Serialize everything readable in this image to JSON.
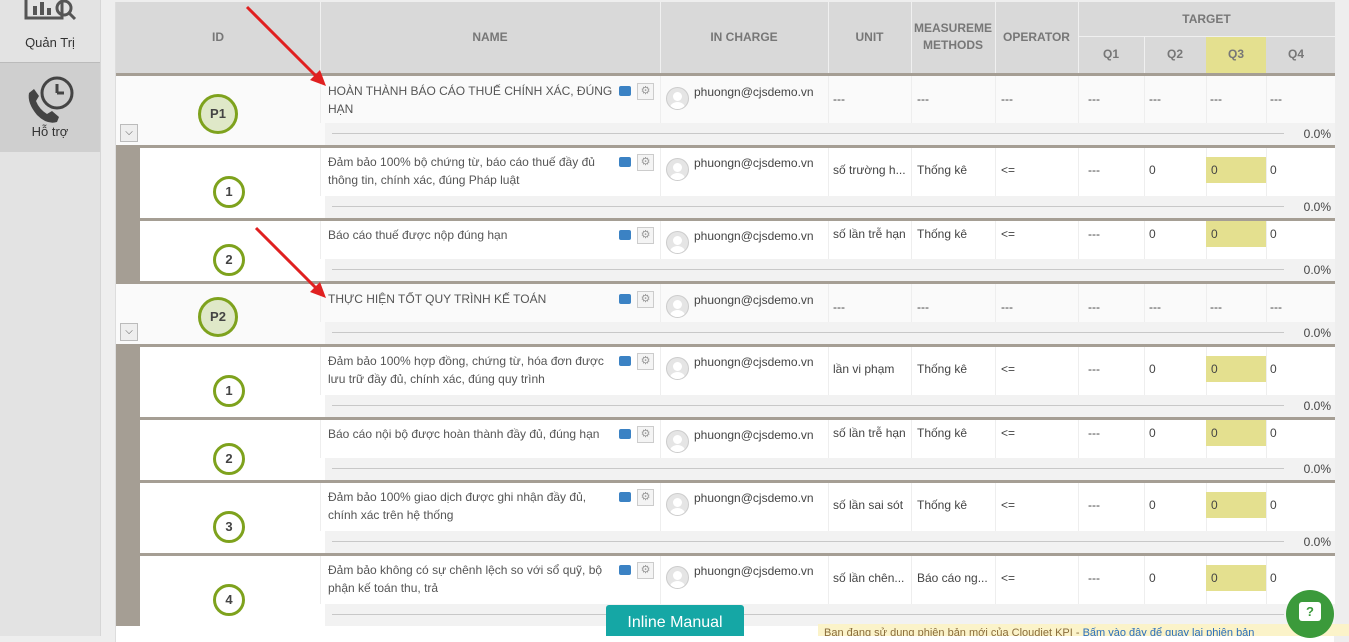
{
  "sidebar": {
    "items": [
      {
        "label": "Quản Trị",
        "icon": "admin-chart-icon"
      },
      {
        "label": "Hỗ trợ",
        "icon": "phone-clock-icon"
      }
    ]
  },
  "table": {
    "headers": {
      "id": "ID",
      "name": "NAME",
      "in_charge": "IN CHARGE",
      "unit": "UNIT",
      "methods": "MEASUREMENT METHODS",
      "methods_line1": "MEASUREME",
      "methods_line2": "METHODS",
      "operator": "OPERATOR",
      "target": "TARGET",
      "q1": "Q1",
      "q2": "Q2",
      "q3": "Q3",
      "q4": "Q4"
    },
    "rows": [
      {
        "type": "parent",
        "id": "P1",
        "name": "HOÀN THÀNH BÁO CÁO THUẾ CHÍNH XÁC, ĐÚNG HẠN",
        "in_charge": "phuongn@cjsdemo.vn",
        "unit": "---",
        "method": "---",
        "operator": "---",
        "q1": "---",
        "q2": "---",
        "q3": "---",
        "q4": "---",
        "progress": "0.0%"
      },
      {
        "type": "child",
        "id": "1",
        "name": "Đảm bảo 100% bộ chứng từ, báo cáo thuế đầy đủ thông tin, chính xác, đúng Pháp luật",
        "in_charge": "phuongn@cjsdemo.vn",
        "unit": "số trường h...",
        "method": "Thống kê",
        "operator": "<=",
        "q1": "---",
        "q2": "0",
        "q3": "0",
        "q4": "0",
        "progress": "0.0%"
      },
      {
        "type": "child",
        "id": "2",
        "name": "Báo cáo thuế được nộp đúng hạn",
        "in_charge": "phuongn@cjsdemo.vn",
        "unit": "số lần trễ hạn",
        "method": "Thống kê",
        "operator": "<=",
        "q1": "---",
        "q2": "0",
        "q3": "0",
        "q4": "0",
        "progress": "0.0%"
      },
      {
        "type": "parent",
        "id": "P2",
        "name": "THỰC HIỆN TỐT QUY TRÌNH KẾ TOÁN",
        "in_charge": "phuongn@cjsdemo.vn",
        "unit": "---",
        "method": "---",
        "operator": "---",
        "q1": "---",
        "q2": "---",
        "q3": "---",
        "q4": "---",
        "progress": "0.0%"
      },
      {
        "type": "child",
        "id": "1",
        "name": "Đảm bảo 100% hợp đồng, chứng từ, hóa đơn được lưu trữ đầy đủ, chính xác, đúng quy trình",
        "in_charge": "phuongn@cjsdemo.vn",
        "unit": "lần vi phạm",
        "method": "Thống kê",
        "operator": "<=",
        "q1": "---",
        "q2": "0",
        "q3": "0",
        "q4": "0",
        "progress": "0.0%"
      },
      {
        "type": "child",
        "id": "2",
        "name": "Báo cáo nội bộ được hoàn thành đầy đủ, đúng hạn",
        "in_charge": "phuongn@cjsdemo.vn",
        "unit": "số lần trễ hạn",
        "method": "Thống kê",
        "operator": "<=",
        "q1": "---",
        "q2": "0",
        "q3": "0",
        "q4": "0",
        "progress": "0.0%"
      },
      {
        "type": "child",
        "id": "3",
        "name": "Đảm bảo 100% giao dịch được ghi nhận đầy đủ, chính xác trên hệ thống",
        "in_charge": "phuongn@cjsdemo.vn",
        "unit": "số lần sai sót",
        "method": "Thống kê",
        "operator": "<=",
        "q1": "---",
        "q2": "0",
        "q3": "0",
        "q4": "0",
        "progress": "0.0%"
      },
      {
        "type": "child",
        "id": "4",
        "name": "Đảm bảo không có sự chênh lệch so với sổ quỹ, bộ phận kế toán thu, trả",
        "in_charge": "phuongn@cjsdemo.vn",
        "unit": "số lần chên...",
        "method": "Báo cáo ng...",
        "operator": "<=",
        "q1": "---",
        "q2": "0",
        "q3": "0",
        "q4": "0",
        "progress": ""
      }
    ]
  },
  "overlay": {
    "inline_manual": "Inline Manual",
    "notice_text": "Bạn đang sử dụng phiên bản mới của Cloudjet KPI - ",
    "notice_link": "Bấm vào đây để quay lại phiên bản",
    "help_icon": "?"
  },
  "colors": {
    "accent_green": "#7ea21d",
    "q3_highlight": "#e4e08f",
    "row_divider": "#a59e94",
    "arrow_red": "#e02020",
    "inline_manual_bg": "#15a7a5",
    "help_button": "#3b9a3b"
  }
}
